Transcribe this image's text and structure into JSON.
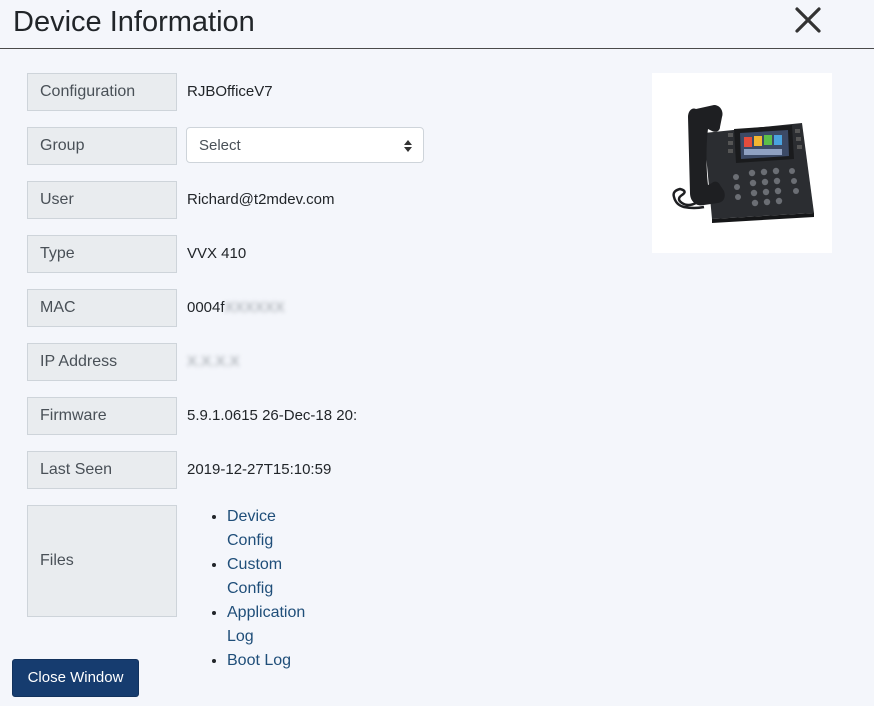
{
  "header": {
    "title": "Device Information"
  },
  "fields": {
    "configuration": {
      "label": "Configuration",
      "value": "RJBOfficeV7"
    },
    "group": {
      "label": "Group",
      "selected": "Select"
    },
    "user": {
      "label": "User",
      "value": "Richard@t2mdev.com"
    },
    "type": {
      "label": "Type",
      "value": "VVX 410"
    },
    "mac": {
      "label": "MAC",
      "value_visible": "0004f",
      "value_blurred": "XXXXXX"
    },
    "ip": {
      "label": "IP Address",
      "value_blurred": "X.X.X.X"
    },
    "firmware": {
      "label": "Firmware",
      "value": "5.9.1.0615 26-Dec-18 20:"
    },
    "last_seen": {
      "label": "Last Seen",
      "value": "2019-12-27T15:10:59"
    },
    "files": {
      "label": "Files",
      "links": [
        "Device Config",
        "Custom Config",
        "Application Log",
        "Boot Log"
      ]
    }
  },
  "footer": {
    "close_window_label": "Close Window"
  },
  "colors": {
    "primary_button": "#163c6f",
    "link": "#1f4e79",
    "label_bg": "#e9ecef",
    "page_bg": "#f4f6fb"
  }
}
